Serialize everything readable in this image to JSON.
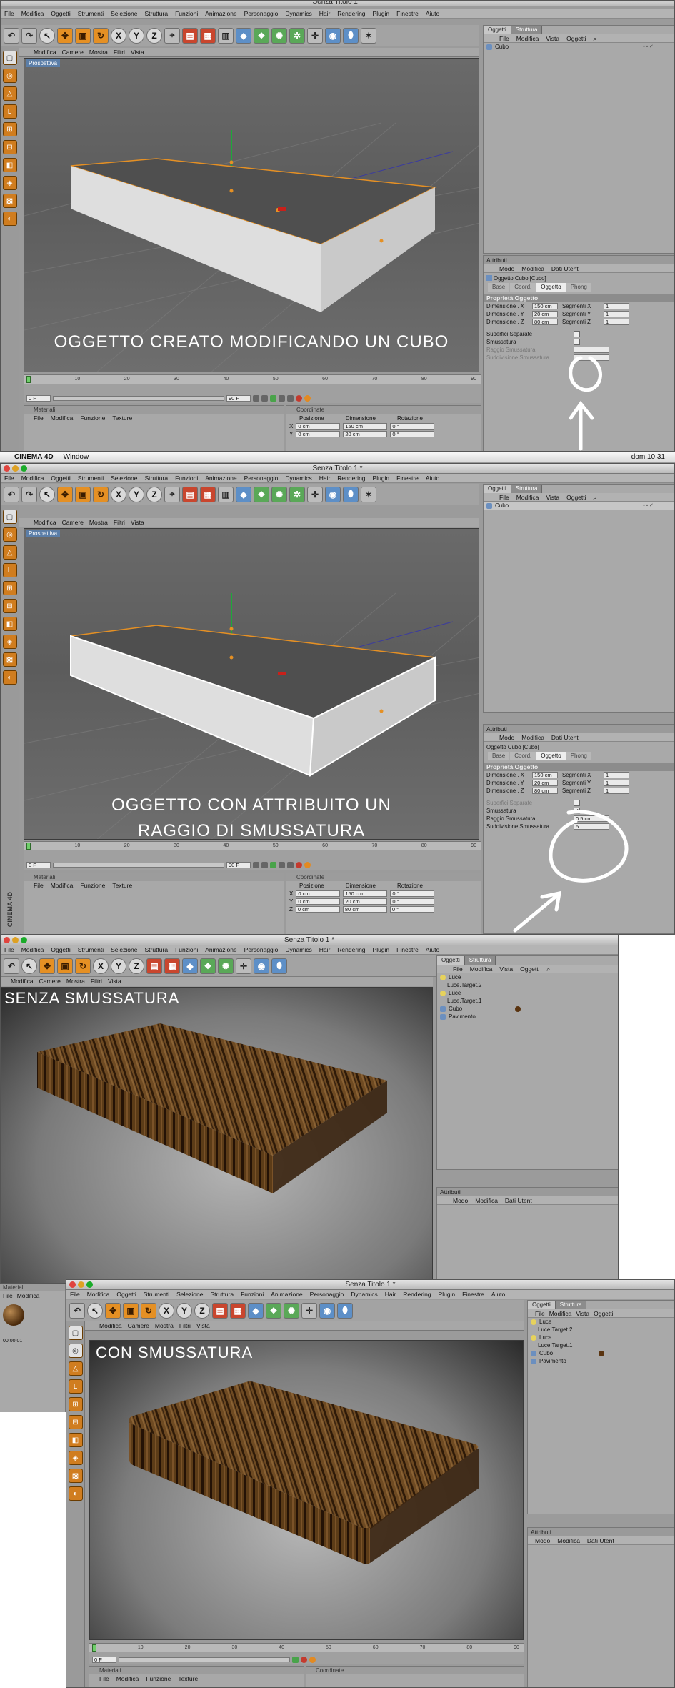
{
  "title": "Senza Titolo 1 *",
  "menus": [
    "File",
    "Modifica",
    "Oggetti",
    "Strumenti",
    "Selezione",
    "Struttura",
    "Funzioni",
    "Animazione",
    "Personaggio",
    "Dynamics",
    "Hair",
    "Rendering",
    "Plugin",
    "Finestre",
    "Aiuto"
  ],
  "viewport_menu": [
    "Modifica",
    "Camere",
    "Mostra",
    "Filtri",
    "Vista"
  ],
  "viewport_label": "Prospettiva",
  "objects_panel": {
    "tabs": [
      "Oggetti",
      "Struttura"
    ],
    "menu": [
      "File",
      "Modifica",
      "Vista",
      "Oggetti"
    ],
    "items_simple": [
      "Cubo"
    ],
    "items_scene": [
      "Luce",
      "Luce.Target.2",
      "Luce",
      "Luce.Target.1",
      "Cubo",
      "Pavimento"
    ]
  },
  "attributes": {
    "header": "Attributi",
    "menu": [
      "Modo",
      "Modifica",
      "Dati Utent"
    ],
    "object_title": "Oggetto Cubo [Cubo]",
    "tabs": [
      "Base",
      "Coord.",
      "Oggetto",
      "Phong"
    ],
    "section": "Proprietà Oggetto",
    "dims": [
      {
        "label": "Dimensione . X",
        "value": "150 cm",
        "seg_label": "Segmenti X",
        "seg": "1"
      },
      {
        "label": "Dimensione . Y",
        "value": "20 cm",
        "seg_label": "Segmenti Y",
        "seg": "1"
      },
      {
        "label": "Dimensione . Z",
        "value": "80 cm",
        "seg_label": "Segmenti Z",
        "seg": "1"
      }
    ],
    "checks": [
      "Superfici Separate",
      "Smussatura"
    ],
    "fillet": [
      {
        "label": "Raggio Smussatura",
        "value": "0.5 cm"
      },
      {
        "label": "Suddivisione Smussatura",
        "value": "5"
      }
    ]
  },
  "timeline": {
    "ticks": [
      "0",
      "10",
      "20",
      "30",
      "40",
      "50",
      "60",
      "70",
      "80",
      "90"
    ],
    "start": "0 F",
    "end": "90 F",
    "current": "0 F"
  },
  "materials": {
    "header": "Materiali",
    "menu": [
      "File",
      "Modifica",
      "Funzione",
      "Texture"
    ]
  },
  "coordinates": {
    "header": "Coordinate",
    "cols": [
      "Posizione",
      "Dimensione",
      "Rotazione"
    ],
    "rows": [
      {
        "axis": "X",
        "pos": "0 cm",
        "dim": "150 cm",
        "rot_axis": "H",
        "rot": "0 °"
      },
      {
        "axis": "Y",
        "pos": "0 cm",
        "dim": "20 cm",
        "rot_axis": "P",
        "rot": "0 °"
      },
      {
        "axis": "Z",
        "pos": "0 cm",
        "dim": "80 cm",
        "rot_axis": "B",
        "rot": "0 °"
      }
    ]
  },
  "mac_menubar": {
    "app": "CINEMA 4D",
    "window": "Window",
    "clock": "dom 10:31"
  },
  "captions": {
    "first": "OGGETTO CREATO MODIFICANDO UN CUBO",
    "second_line1": "OGGETTO CON ATTRIBUITO UN",
    "second_line2": "RAGGIO DI SMUSSATURA",
    "third": "SENZA SMUSSATURA",
    "fourth": "CON SMUSSATURA"
  },
  "side_label": "CINEMA 4D",
  "small_material_time": "00:00:01",
  "colors": {
    "ui_gray": "#9b9b9b",
    "accent_orange": "#e59024",
    "selection_blue": "#5b7ea8"
  }
}
